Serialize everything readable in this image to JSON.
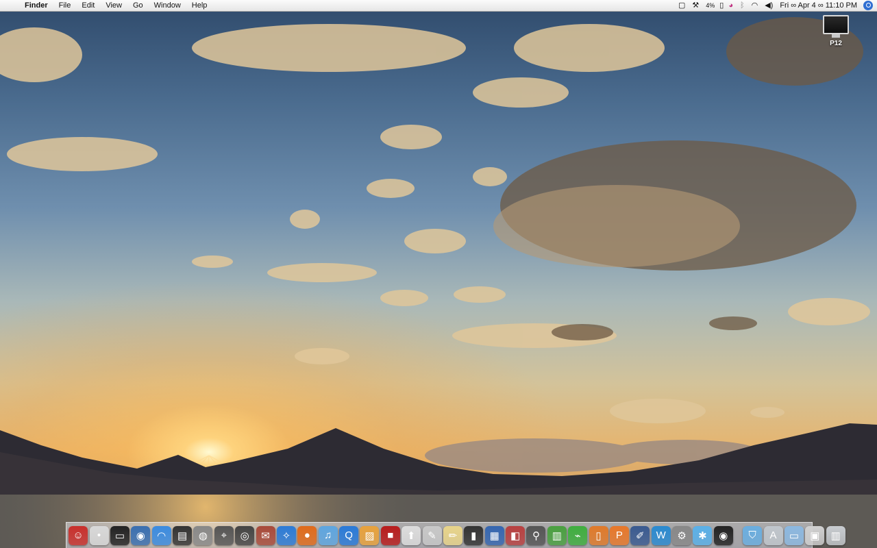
{
  "menubar": {
    "app_name": "Finder",
    "menus": [
      "File",
      "Edit",
      "View",
      "Go",
      "Window",
      "Help"
    ],
    "status": {
      "battery_percent": "4%",
      "clock": "Fri ∞ Apr 4 ∞ 11:10 PM"
    }
  },
  "desktop": {
    "drive_label": "P12"
  },
  "dock": {
    "apps": [
      {
        "icon": "finder-icon",
        "color": "#c9302c"
      },
      {
        "icon": "system-info-icon",
        "color": "#d8d8d8"
      },
      {
        "icon": "terminal-icon",
        "color": "#222222"
      },
      {
        "icon": "network-icon",
        "color": "#3a6fb0"
      },
      {
        "icon": "airport-icon",
        "color": "#3a8be0"
      },
      {
        "icon": "activity-monitor-icon",
        "color": "#333333"
      },
      {
        "icon": "disk-utility-icon",
        "color": "#888888"
      },
      {
        "icon": "network-utility-icon",
        "color": "#555555"
      },
      {
        "icon": "dvd-player-icon",
        "color": "#444444"
      },
      {
        "icon": "stamp-icon",
        "color": "#a84a3a"
      },
      {
        "icon": "safari-icon",
        "color": "#2c7bd6"
      },
      {
        "icon": "firefox-icon",
        "color": "#e06b1b"
      },
      {
        "icon": "itunes-icon",
        "color": "#5ea6e0"
      },
      {
        "icon": "quicktime-icon",
        "color": "#2a7ad8"
      },
      {
        "icon": "iphoto-icon",
        "color": "#e8a23c"
      },
      {
        "icon": "photo-booth-icon",
        "color": "#b81c1c"
      },
      {
        "icon": "flickr-uploadr-icon",
        "color": "#dcdcdc"
      },
      {
        "icon": "script-editor-icon",
        "color": "#c8c8c8"
      },
      {
        "icon": "textedit-icon",
        "color": "#e8d48a"
      },
      {
        "icon": "file-icon",
        "color": "#333333"
      },
      {
        "icon": "remote-desktop-icon",
        "color": "#3566b0"
      },
      {
        "icon": "parallels-icon",
        "color": "#b84040"
      },
      {
        "icon": "preview-icon",
        "color": "#555555"
      },
      {
        "icon": "grapher-icon",
        "color": "#4aa040"
      },
      {
        "icon": "grabber-icon",
        "color": "#3fae3f"
      },
      {
        "icon": "keynote-icon",
        "color": "#e07a2a"
      },
      {
        "icon": "pages-icon",
        "color": "#e8782a"
      },
      {
        "icon": "pencil-icon",
        "color": "#3a5a90"
      },
      {
        "icon": "word-icon",
        "color": "#2a8ad0"
      },
      {
        "icon": "automator-icon",
        "color": "#888888"
      },
      {
        "icon": "snowflake-icon",
        "color": "#5ab0e8"
      },
      {
        "icon": "camera-icon",
        "color": "#222222"
      }
    ],
    "others": [
      {
        "icon": "shield-icon",
        "color": "#6aaee0"
      },
      {
        "icon": "applications-folder-icon",
        "color": "#c0c6cc"
      },
      {
        "icon": "documents-folder-icon",
        "color": "#8cb8e0"
      },
      {
        "icon": "downloads-stack-icon",
        "color": "#d0d0d0"
      },
      {
        "icon": "trash-icon",
        "color": "#c8ccd0"
      }
    ]
  }
}
